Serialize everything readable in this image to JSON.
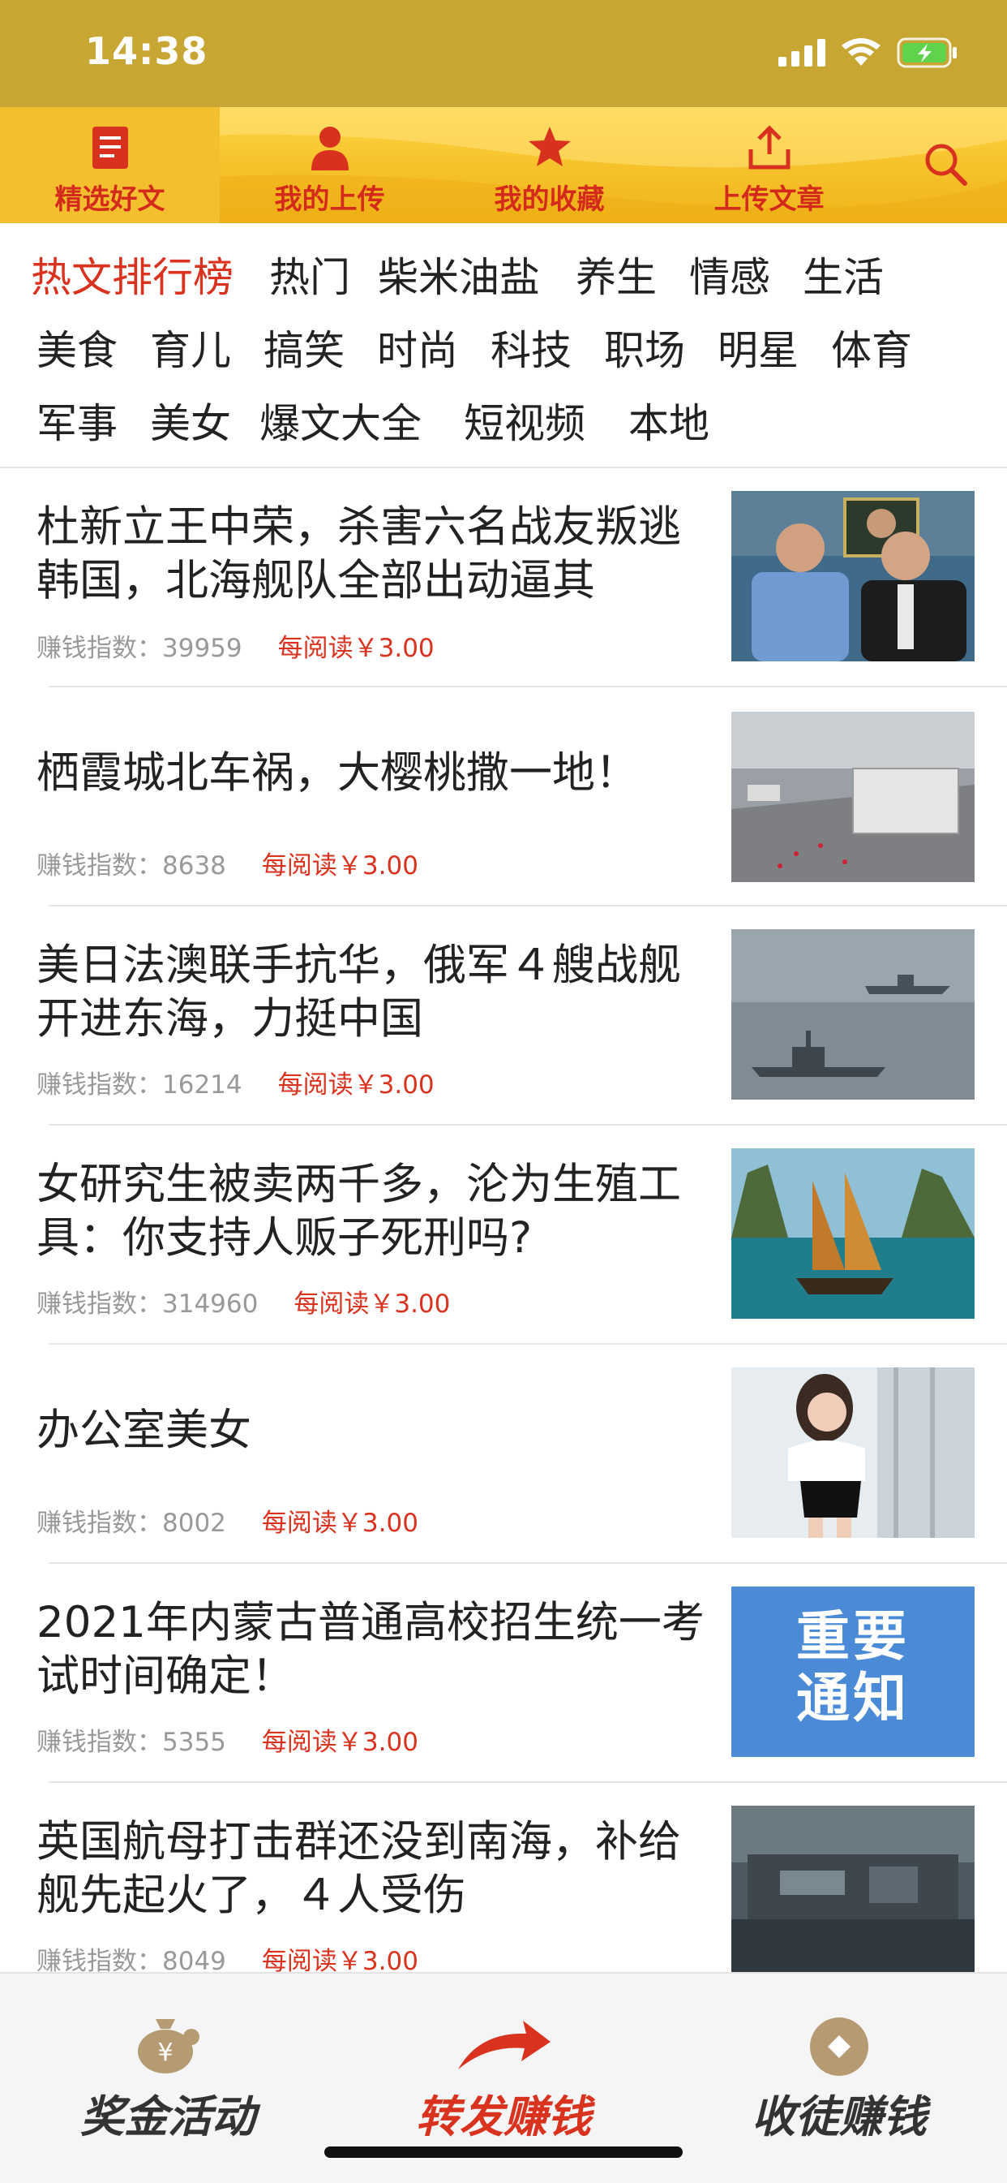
{
  "status_bar": {
    "time": "14:38"
  },
  "top_nav": {
    "items": [
      {
        "label": "精选好文",
        "icon": "document-icon",
        "active": true
      },
      {
        "label": "我的上传",
        "icon": "user-icon",
        "active": false
      },
      {
        "label": "我的收藏",
        "icon": "star-icon",
        "active": false
      },
      {
        "label": "上传文章",
        "icon": "upload-icon",
        "active": false
      }
    ],
    "search_icon": "search-icon"
  },
  "categories": [
    "热文排行榜",
    "热门",
    "柴米油盐",
    "养生",
    "情感",
    "生活",
    "美食",
    "育儿",
    "搞笑",
    "时尚",
    "科技",
    "职场",
    "明星",
    "体育",
    "军事",
    "美女",
    "爆文大全",
    "短视频",
    "本地"
  ],
  "articles": [
    {
      "title": "杜新立王中荣，杀害六名战友叛逃韩国，北海舰队全部出动逼其",
      "index_label": "赚钱指数：",
      "index": "39959",
      "price": "每阅读￥3.00"
    },
    {
      "title": "栖霞城北车祸，大樱桃撒一地！",
      "index_label": "赚钱指数：",
      "index": "8638",
      "price": "每阅读￥3.00"
    },
    {
      "title": "美日法澳联手抗华，俄军４艘战舰开进东海，力挺中国",
      "index_label": "赚钱指数：",
      "index": "16214",
      "price": "每阅读￥3.00"
    },
    {
      "title": "女研究生被卖两千多，沦为生殖工具：你支持人贩子死刑吗?",
      "index_label": "赚钱指数：",
      "index": "314960",
      "price": "每阅读￥3.00"
    },
    {
      "title": "办公室美女",
      "index_label": "赚钱指数：",
      "index": "8002",
      "price": "每阅读￥3.00"
    },
    {
      "title": "2021年内蒙古普通高校招生统一考试时间确定！",
      "index_label": "赚钱指数：",
      "index": "5355",
      "price": "每阅读￥3.00",
      "thumb_text": [
        "重要",
        "通知"
      ]
    },
    {
      "title": "英国航母打击群还没到南海，补给舰先起火了，４人受伤",
      "index_label": "赚钱指数：",
      "index": "8049",
      "price": "每阅读￥3.00"
    }
  ],
  "bottom_tabs": [
    {
      "label": "奖金活动",
      "icon": "money-bag-icon",
      "active": false
    },
    {
      "label": "转发赚钱",
      "icon": "share-arrow-icon",
      "active": true
    },
    {
      "label": "收徒赚钱",
      "icon": "coin-icon",
      "active": false
    }
  ],
  "colors": {
    "accent": "#d9321e",
    "status_bar": "#c8a634",
    "nav_gold": "#f6c22b"
  }
}
